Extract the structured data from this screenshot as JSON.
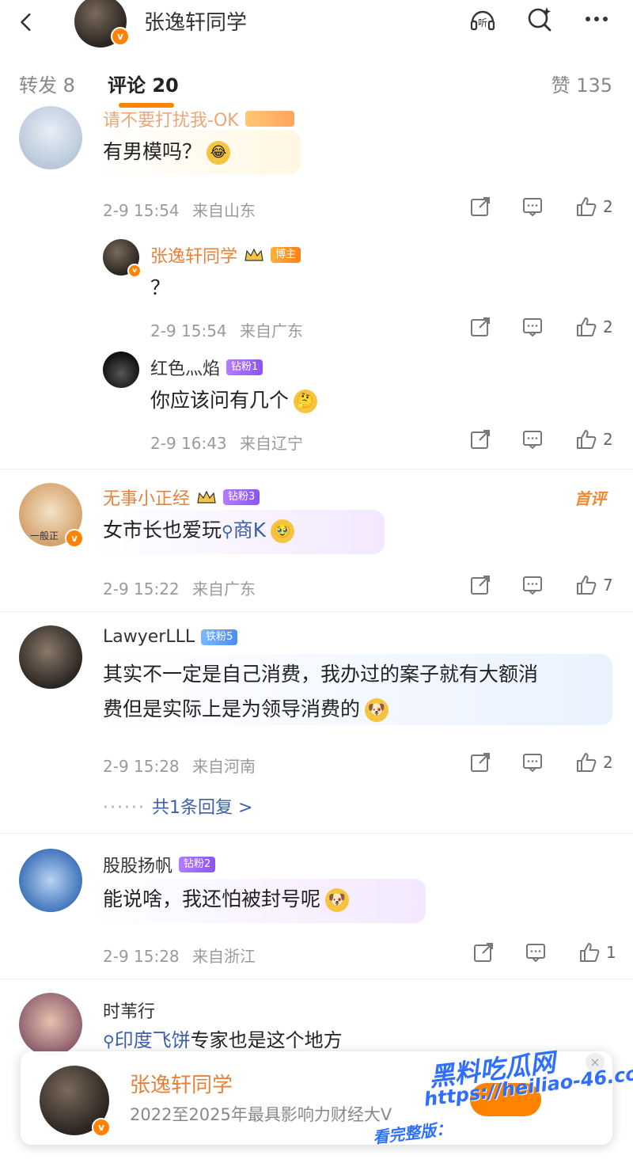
{
  "header": {
    "account_name": "张逸轩同学",
    "icons": [
      "back-arrow-icon",
      "listen-icon",
      "search-sparkle-icon",
      "more-icon"
    ],
    "listen_label": "听"
  },
  "tabs": {
    "repost": "转发 8",
    "comment": "评论 20",
    "like": "赞 135"
  },
  "comments": [
    {
      "name": "请不要打扰我-OK",
      "text": "有男模吗？",
      "time": "2-9 15:54",
      "location": "来自山东",
      "likes": "2",
      "replies": [
        {
          "name": "张逸轩同学",
          "badge": "博主",
          "text": "？",
          "time": "2-9 15:54",
          "location": "来自广东",
          "likes": "2"
        },
        {
          "name": "红色灬焰",
          "badge": "钻粉1",
          "text": "你应该问有几个",
          "time": "2-9 16:43",
          "location": "来自辽宁",
          "likes": "2"
        }
      ]
    },
    {
      "name": "无事小正经",
      "badge": "钻粉3",
      "flag": "首评",
      "avatar_text": "一般正",
      "text_main": "女市长也爱玩",
      "text_link": "商K",
      "time": "2-9 15:22",
      "location": "来自广东",
      "likes": "7"
    },
    {
      "name": "LawyerLLL",
      "badge": "铁粉5",
      "text_line1": "其实不一定是自己消费，我办过的案子就有大额消",
      "text_line2": "费但是实际上是为领导消费的",
      "time": "2-9 15:28",
      "location": "来自河南",
      "likes": "2",
      "reply_link": "共1条回复 >"
    },
    {
      "name": "股股扬帆",
      "badge": "钻粉2",
      "text": "能说啥，我还怕被封号呢",
      "time": "2-9 15:28",
      "location": "来自浙江",
      "likes": "1"
    },
    {
      "name": "时苇行",
      "text_link": "印度飞饼",
      "text_rest": "专家也是这个地方"
    }
  ],
  "card": {
    "name": "张逸轩同学",
    "desc": "2022至2025年最具影响力财经大V"
  },
  "watermark": {
    "title": "黑料吃瓜网",
    "url": "https://heiliao-46.com",
    "tag": "看完整版："
  },
  "colors": {
    "accent": "#ff8200",
    "name_orange": "#e8813a",
    "link": "#3b5fa8",
    "meta": "#9a9a9a"
  }
}
